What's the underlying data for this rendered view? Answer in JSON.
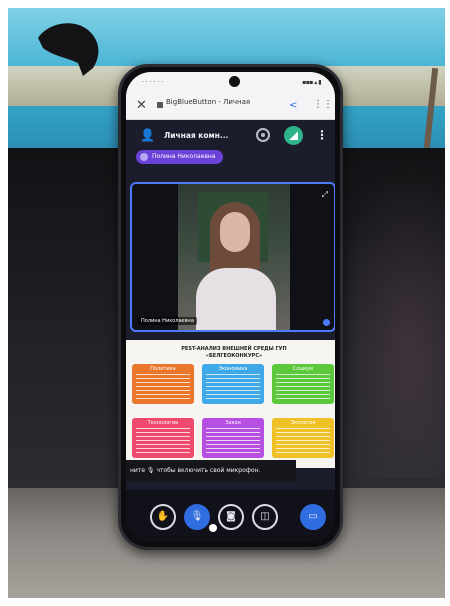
{
  "colors": {
    "accent_blue": "#2f6de0",
    "chip_purple": "#6a42d8",
    "app_background": "#1b1d2c",
    "card_orange": "#e9762b",
    "card_blue": "#3fa8e8",
    "card_green": "#5cc93c",
    "card_pink": "#ef4a6e",
    "card_purple": "#b74fe3",
    "card_yellow": "#f0c126"
  },
  "browser": {
    "tab_title": "BigBlueButton - Личная",
    "close_icon": "close-icon",
    "share_icon": "share-icon",
    "menu_icon": "menu-icon"
  },
  "app": {
    "room_name": "Личная комн...",
    "user_chip": "Полина Николаевна",
    "icons": [
      "user-icon",
      "record-icon",
      "signal-icon",
      "more-vertical-icon"
    ]
  },
  "video": {
    "speaker_name": "Полина Николаевна",
    "expand_icon": "expand-icon"
  },
  "slide": {
    "title_line1": "PEST-АНАЛИЗ ВНЕШНЕЙ СРЕДЫ ГУП",
    "title_line2": "«БЕЛГЕОКОНКУРС»",
    "cards": [
      {
        "label": "Политика",
        "color": "#e9762b"
      },
      {
        "label": "Экономика",
        "color": "#3fa8e8"
      },
      {
        "label": "Социум",
        "color": "#5cc93c"
      },
      {
        "label": "Технологии",
        "color": "#ef4a6e"
      },
      {
        "label": "Закон",
        "color": "#b74fe3"
      },
      {
        "label": "Экология",
        "color": "#f0c126"
      }
    ]
  },
  "toast": {
    "text": "ните 🎙 чтобы включить свой микрофон."
  },
  "controls": {
    "icons": [
      "raise-hand-icon",
      "microphone-icon",
      "camera-off-icon",
      "screen-share-icon",
      "presentation-icon"
    ]
  }
}
